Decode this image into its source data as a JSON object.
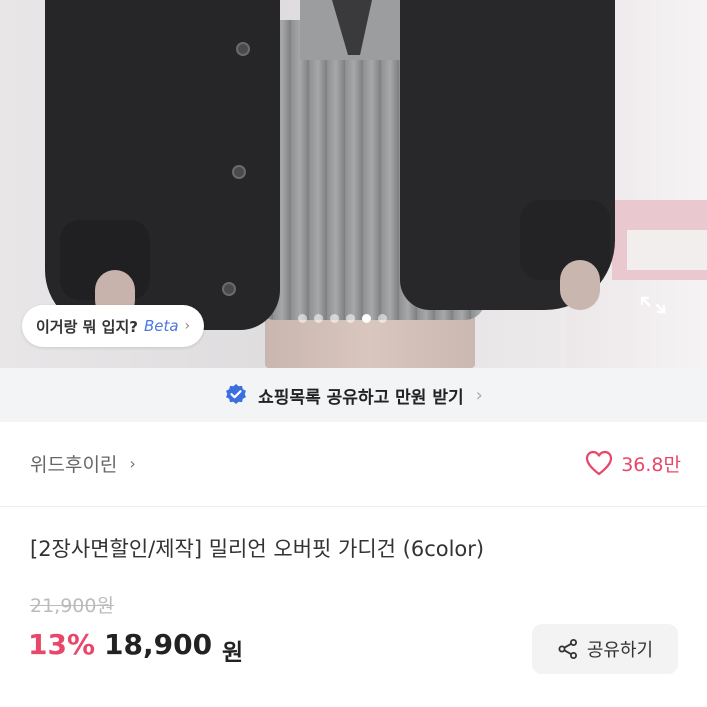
{
  "hero": {
    "ai_chip": {
      "question": "이거랑 뭐 입지?",
      "beta": "Beta",
      "chevron": "›"
    },
    "carousel": {
      "total": 6,
      "active_index": 4
    },
    "expand_icon": "expand-icon"
  },
  "promo": {
    "icon": "verified-check-icon",
    "text": "쇼핑목록 공유하고 만원 받기",
    "chevron": "›",
    "accent": "#3b6fe0"
  },
  "seller": {
    "name": "위드후이린",
    "chevron": "›"
  },
  "like": {
    "icon": "heart-outline-icon",
    "count": "36.8만",
    "color": "#e8476a"
  },
  "product": {
    "title": "[2장사면할인/제작] 밀리언 오버핏 가디건 (6color)"
  },
  "pricing": {
    "original_price": "21,900원",
    "discount_rate": "13%",
    "sale_price": "18,900",
    "currency": "원"
  },
  "share": {
    "icon": "share-icon",
    "label": "공유하기"
  }
}
